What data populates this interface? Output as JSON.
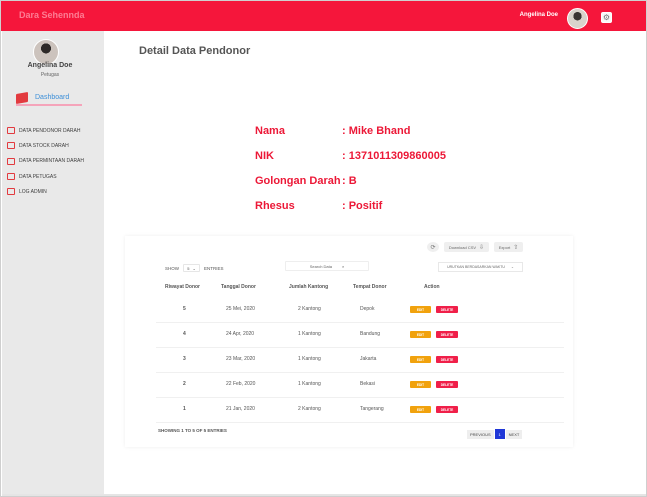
{
  "header": {
    "brand": "Dara Sehennda",
    "user_name": "Angelina Doe",
    "gear_icon": "gear-icon"
  },
  "sidebar": {
    "profile": {
      "name": "Angelina Doe",
      "role": "Petugas"
    },
    "dashboard_label": "Dashboard",
    "items": [
      {
        "label": "DATA PENDONOR DARAH",
        "icon": "donor-icon"
      },
      {
        "label": "DATA STOCK DARAH",
        "icon": "stock-icon"
      },
      {
        "label": "DATA PERMINTAAN DARAH",
        "icon": "request-icon"
      },
      {
        "label": "DATA PETUGAS",
        "icon": "staff-icon"
      },
      {
        "label": "LOG ADMIN",
        "icon": "log-icon"
      }
    ]
  },
  "main": {
    "title": "Detail Data Pendonor",
    "details": [
      {
        "label": "Nama",
        "value": ": Mike Bhand"
      },
      {
        "label": "NIK",
        "value": ": 1371011309860005"
      },
      {
        "label": "Golongan Darah",
        "value": ": B"
      },
      {
        "label": "Rhesus",
        "value": ": Positif"
      }
    ]
  },
  "table": {
    "download_pdf": "Download CSV",
    "export_label": "Export",
    "show_label": "SHOW",
    "entries_label": "ENTRIES",
    "entries_value": "5",
    "search_placeholder": "Search Data",
    "sort_label": "URUTKAN BERDASARKAN WAKTU",
    "columns": [
      "Riwayat Donor",
      "Tanggal Donor",
      "Jumlah Kantong",
      "Tempat Donor",
      "Action"
    ],
    "rows": [
      [
        "5",
        "25 Mei, 2020",
        "2 Kantong",
        "Depok"
      ],
      [
        "4",
        "24 Apr, 2020",
        "1 Kantong",
        "Bandung"
      ],
      [
        "3",
        "23 Mar, 2020",
        "1 Kantong",
        "Jakarta"
      ],
      [
        "2",
        "22 Feb, 2020",
        "1 Kantong",
        "Bekasi"
      ],
      [
        "1",
        "21 Jan, 2020",
        "2 Kantong",
        "Tangerang"
      ]
    ],
    "edit_label": "EDIT",
    "delete_label": "DELETE",
    "summary": "SHOWING 1 TO 5 OF 5 ENTRIES",
    "prev_label": "PREVIOUS",
    "current_page": "1",
    "next_label": "NEXT"
  }
}
